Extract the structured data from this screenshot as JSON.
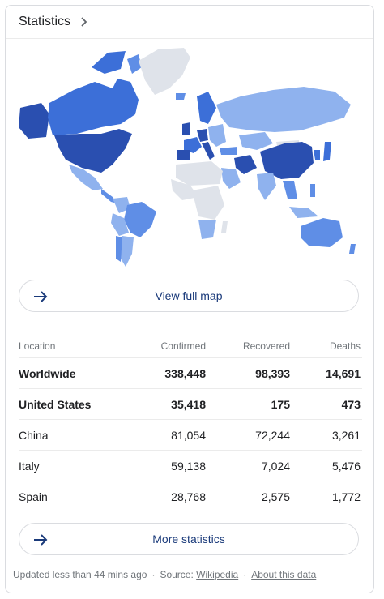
{
  "header": {
    "title": "Statistics"
  },
  "map": {
    "colors": {
      "ocean": "#ffffff",
      "none": "#dfe3ea",
      "low": "#8fb2ee",
      "mid": "#5f8ee6",
      "high": "#3c6fd8",
      "top": "#2a4fb0"
    }
  },
  "buttons": {
    "view_map": "View full map",
    "more_stats": "More statistics"
  },
  "table": {
    "columns": [
      "Location",
      "Confirmed",
      "Recovered",
      "Deaths"
    ],
    "rows": [
      {
        "location": "Worldwide",
        "confirmed": "338,448",
        "recovered": "98,393",
        "deaths": "14,691"
      },
      {
        "location": "United States",
        "confirmed": "35,418",
        "recovered": "175",
        "deaths": "473"
      },
      {
        "location": "China",
        "confirmed": "81,054",
        "recovered": "72,244",
        "deaths": "3,261"
      },
      {
        "location": "Italy",
        "confirmed": "59,138",
        "recovered": "7,024",
        "deaths": "5,476"
      },
      {
        "location": "Spain",
        "confirmed": "28,768",
        "recovered": "2,575",
        "deaths": "1,772"
      }
    ]
  },
  "footer": {
    "updated": "Updated less than 44 mins ago",
    "separator": "·",
    "source_label": "Source:",
    "source_link": "Wikipedia",
    "about": "About this data"
  }
}
